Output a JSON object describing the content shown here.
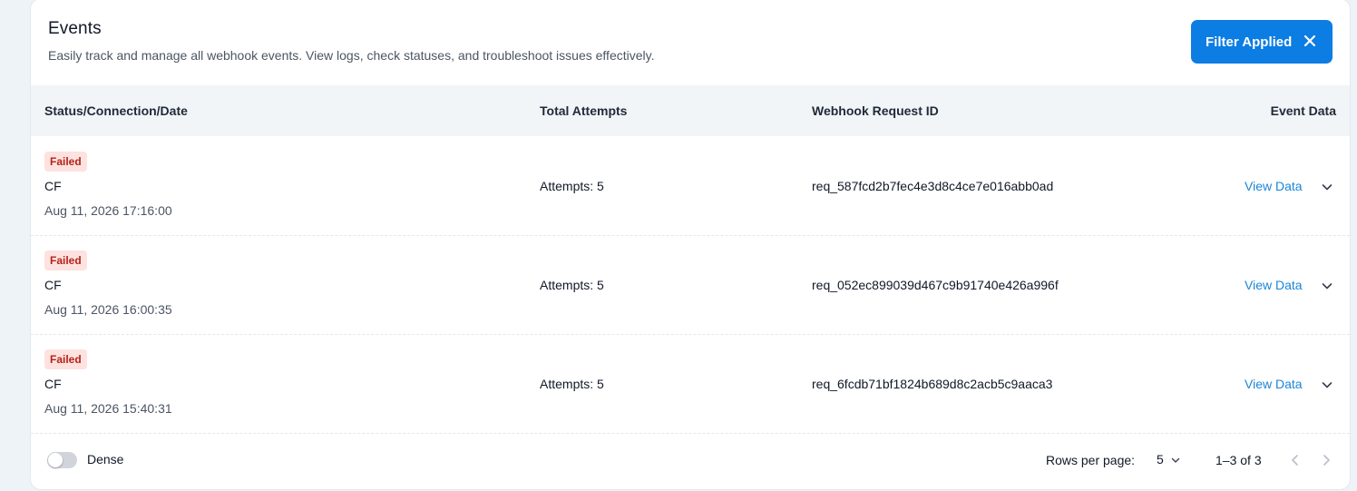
{
  "header": {
    "title": "Events",
    "subtitle": "Easily track and manage all webhook events. View logs, check statuses, and troubleshoot issues effectively.",
    "filter_button_label": "Filter Applied"
  },
  "table": {
    "columns": [
      "Status/Connection/Date",
      "Total Attempts",
      "Webhook Request ID",
      "Event Data"
    ],
    "rows": [
      {
        "status": "Failed",
        "connection": "CF",
        "date": "Aug 11, 2026 17:16:00",
        "attempts": "Attempts: 5",
        "request_id": "req_587fcd2b7fec4e3d8c4ce7e016abb0ad",
        "action": "View Data"
      },
      {
        "status": "Failed",
        "connection": "CF",
        "date": "Aug 11, 2026 16:00:35",
        "attempts": "Attempts: 5",
        "request_id": "req_052ec899039d467c9b91740e426a996f",
        "action": "View Data"
      },
      {
        "status": "Failed",
        "connection": "CF",
        "date": "Aug 11, 2026 15:40:31",
        "attempts": "Attempts: 5",
        "request_id": "req_6fcdb71bf1824b689d8c2acb5c9aaca3",
        "action": "View Data"
      }
    ]
  },
  "footer": {
    "dense_label": "Dense",
    "dense_enabled": false,
    "rows_per_page_label": "Rows per page:",
    "rows_per_page_value": "5",
    "range_text": "1–3 of 3"
  },
  "colors": {
    "primary": "#0b7de3",
    "link": "#1a86d8",
    "failed_bg": "#fde2e0",
    "failed_text": "#b42318",
    "header_bg": "#f1f5f8"
  },
  "icons": {
    "filter_clear": "close-icon",
    "row_expand": "chevron-down-icon",
    "rows_select": "chevron-down-icon",
    "prev_page": "chevron-left-icon",
    "next_page": "chevron-right-icon"
  }
}
